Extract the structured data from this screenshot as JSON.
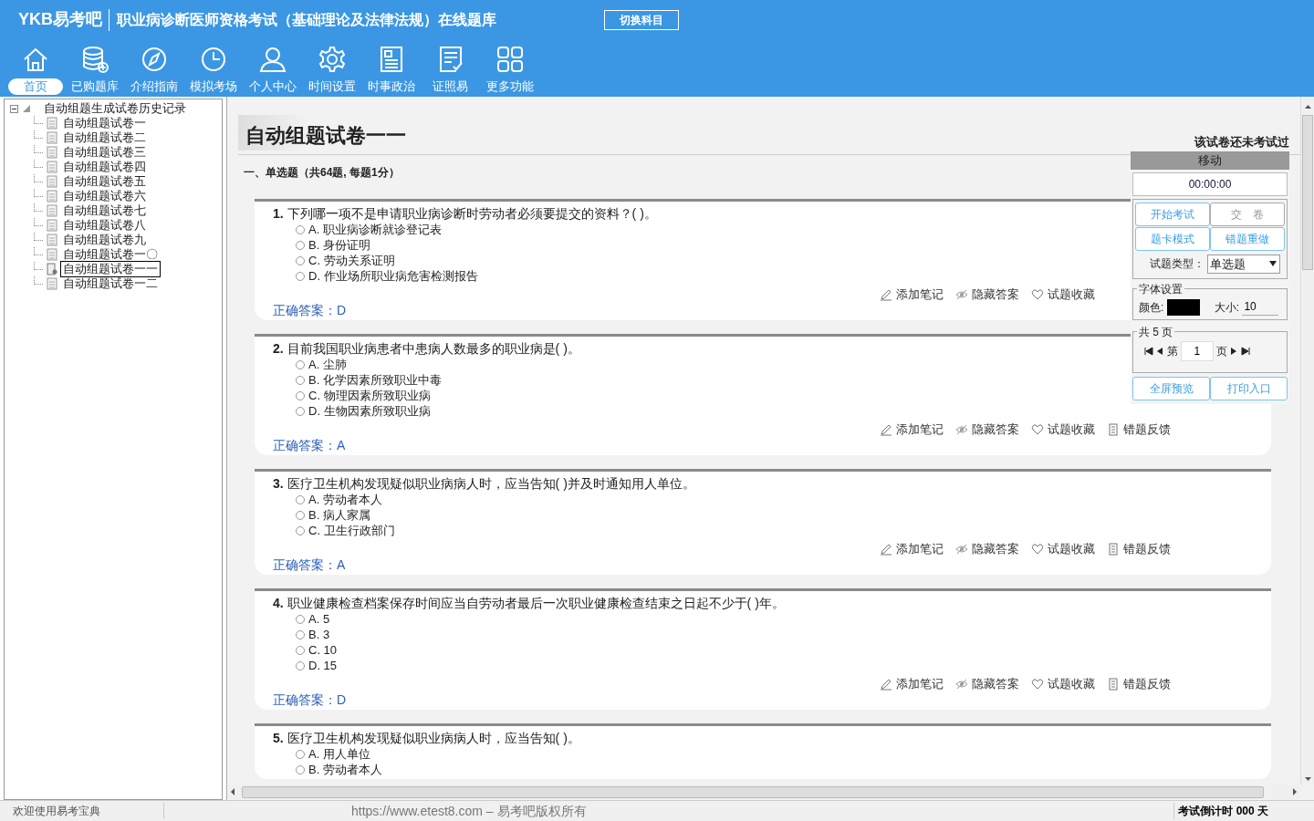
{
  "header": {
    "logo": "YKB易考吧",
    "title": "职业病诊断医师资格考试（基础理论及法律法规）在线题库",
    "switch_button": "切换科目"
  },
  "nav": [
    {
      "label": "首页",
      "selected": true
    },
    {
      "label": "已购题库",
      "selected": false
    },
    {
      "label": "介绍指南",
      "selected": false
    },
    {
      "label": "模拟考场",
      "selected": false
    },
    {
      "label": "个人中心",
      "selected": false
    },
    {
      "label": "时间设置",
      "selected": false
    },
    {
      "label": "时事政治",
      "selected": false
    },
    {
      "label": "证照易",
      "selected": false
    },
    {
      "label": "更多功能",
      "selected": false
    }
  ],
  "tree": {
    "label": "自动组题生成试卷历史记录",
    "expanded": true,
    "children": [
      {
        "label": "自动组题试卷一",
        "selected": false
      },
      {
        "label": "自动组题试卷二",
        "selected": false
      },
      {
        "label": "自动组题试卷三",
        "selected": false
      },
      {
        "label": "自动组题试卷四",
        "selected": false
      },
      {
        "label": "自动组题试卷五",
        "selected": false
      },
      {
        "label": "自动组题试卷六",
        "selected": false
      },
      {
        "label": "自动组题试卷七",
        "selected": false
      },
      {
        "label": "自动组题试卷八",
        "selected": false
      },
      {
        "label": "自动组题试卷九",
        "selected": false
      },
      {
        "label": "自动组题试卷一〇",
        "selected": false
      },
      {
        "label": "自动组题试卷一一",
        "selected": true
      },
      {
        "label": "自动组题试卷一二",
        "selected": false
      }
    ]
  },
  "paper": {
    "title": "自动组题试卷一一",
    "status": "该试卷还未考试过",
    "section": "一、单选题（共64题, 每题1分）"
  },
  "questions": [
    {
      "number": "1.",
      "text": "下列哪一项不是申请职业病诊断时劳动者必须要提交的资料？( )。",
      "options": [
        {
          "label": "A. 职业病诊断就诊登记表",
          "selected": false
        },
        {
          "label": "B. 身份证明",
          "selected": false
        },
        {
          "label": "C. 劳动关系证明",
          "selected": false
        },
        {
          "label": "D. 作业场所职业病危害检测报告",
          "selected": false
        }
      ],
      "actions": [
        "添加笔记",
        "隐藏答案",
        "试题收藏"
      ],
      "answer_label": "正确答案：",
      "answer": "D"
    },
    {
      "number": "2.",
      "text": "目前我国职业病患者中患病人数最多的职业病是( )。",
      "options": [
        {
          "label": "A. 尘肺",
          "selected": false
        },
        {
          "label": "B. 化学因素所致职业中毒",
          "selected": false
        },
        {
          "label": "C. 物理因素所致职业病",
          "selected": false
        },
        {
          "label": "D. 生物因素所致职业病",
          "selected": false
        }
      ],
      "actions": [
        "添加笔记",
        "隐藏答案",
        "试题收藏",
        "错题反馈"
      ],
      "answer_label": "正确答案：",
      "answer": "A"
    },
    {
      "number": "3.",
      "text": "医疗卫生机构发现疑似职业病病人时，应当告知( )并及时通知用人单位。",
      "options": [
        {
          "label": "A. 劳动者本人",
          "selected": false
        },
        {
          "label": "B. 病人家属",
          "selected": false
        },
        {
          "label": "C. 卫生行政部门",
          "selected": false
        }
      ],
      "actions": [
        "添加笔记",
        "隐藏答案",
        "试题收藏",
        "错题反馈"
      ],
      "answer_label": "正确答案：",
      "answer": "A"
    },
    {
      "number": "4.",
      "text": "职业健康检查档案保存时间应当自劳动者最后一次职业健康检查结束之日起不少于( )年。",
      "options": [
        {
          "label": "A. 5",
          "selected": false
        },
        {
          "label": "B. 3",
          "selected": false
        },
        {
          "label": "C. 10",
          "selected": false
        },
        {
          "label": "D. 15",
          "selected": false
        }
      ],
      "actions": [
        "添加笔记",
        "隐藏答案",
        "试题收藏",
        "错题反馈"
      ],
      "answer_label": "正确答案：",
      "answer": "D"
    },
    {
      "number": "5.",
      "text": "医疗卫生机构发现疑似职业病病人时，应当告知( )。",
      "options": [
        {
          "label": "A. 用人单位",
          "selected": false
        },
        {
          "label": "B. 劳动者本人",
          "selected": false
        }
      ]
    }
  ],
  "panel": {
    "move": "移动",
    "timer": "00:00:00",
    "buttons": [
      {
        "label": "开始考试",
        "disabled": false
      },
      {
        "label": "交　卷",
        "disabled": true
      },
      {
        "label": "题卡模式",
        "disabled": false
      },
      {
        "label": "错题重做",
        "disabled": false
      }
    ],
    "type_label": "试题类型：",
    "type_value": "单选题",
    "font_legend": "字体设置",
    "color_label": "颜色:",
    "swatch": {
      "color": "#000000"
    },
    "size_label": "大小:",
    "size_value": "10",
    "pages_legend": "共 5 页",
    "page_prefix": "第",
    "page_value": "1",
    "page_suffix": "页",
    "bottom_buttons": [
      "全屏预览",
      "打印入口"
    ]
  },
  "status_bar": {
    "welcome": "欢迎使用易考宝典",
    "copyright": "https://www.etest8.com – 易考吧版权所有",
    "countdown": "考试倒计时 000 天"
  }
}
